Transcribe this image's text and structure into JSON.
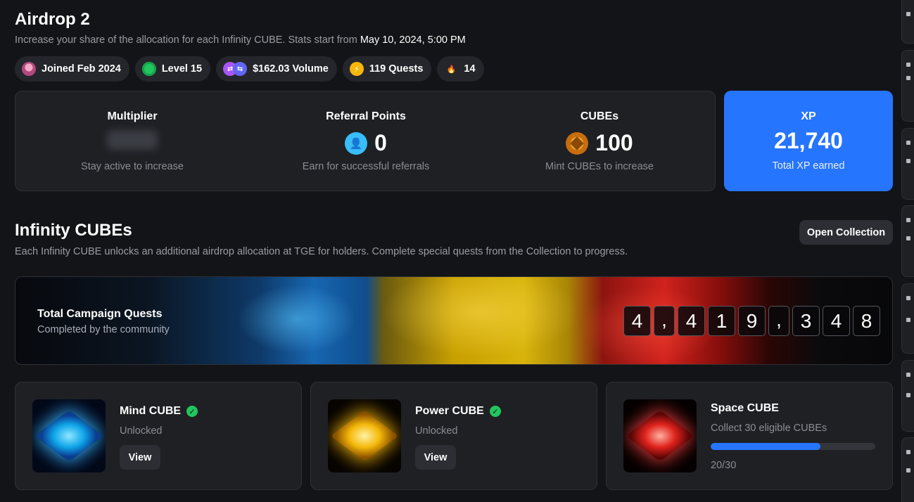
{
  "header": {
    "title": "Airdrop 2",
    "subtitle_prefix": "Increase your share of the allocation for each Infinity CUBE. Stats start from",
    "subtitle_date": "May 10, 2024, 5:00 PM"
  },
  "pills": [
    {
      "label": "Joined Feb 2024",
      "icon": "avatar-icon"
    },
    {
      "label": "Level 15",
      "icon": "level-icon"
    },
    {
      "label": "$162.03 Volume",
      "icon": "volume-icon"
    },
    {
      "label": "119 Quests",
      "icon": "lightning-icon"
    },
    {
      "label": "14",
      "icon": "fire-icon"
    }
  ],
  "stats": {
    "multiplier": {
      "title": "Multiplier",
      "caption": "Stay active to increase"
    },
    "referral": {
      "title": "Referral Points",
      "value": "0",
      "caption": "Earn for successful referrals"
    },
    "cubes": {
      "title": "CUBEs",
      "value": "100",
      "caption": "Mint CUBEs to increase"
    },
    "xp": {
      "title": "XP",
      "value": "21,740",
      "caption": "Total XP earned"
    }
  },
  "infinity": {
    "title": "Infinity CUBEs",
    "subtitle": "Each Infinity CUBE unlocks an additional airdrop allocation at TGE for holders. Complete special quests from the Collection to progress.",
    "open_button": "Open Collection"
  },
  "banner": {
    "title": "Total Campaign Quests",
    "subtitle": "Completed by the community",
    "digits": [
      "4",
      ",",
      "4",
      "1",
      "9",
      ",",
      "3",
      "4",
      "8"
    ]
  },
  "cube_cards": {
    "mind": {
      "name": "Mind CUBE",
      "status": "Unlocked",
      "button": "View"
    },
    "power": {
      "name": "Power CUBE",
      "status": "Unlocked",
      "button": "View"
    },
    "space": {
      "name": "Space CUBE",
      "requirement": "Collect 30 eligible CUBEs",
      "progress_text": "20/30",
      "progress_fraction": 0.6667
    }
  },
  "colors": {
    "accent": "#2675ff",
    "success": "#22c55e",
    "background": "#131417",
    "card": "#1e2024"
  }
}
